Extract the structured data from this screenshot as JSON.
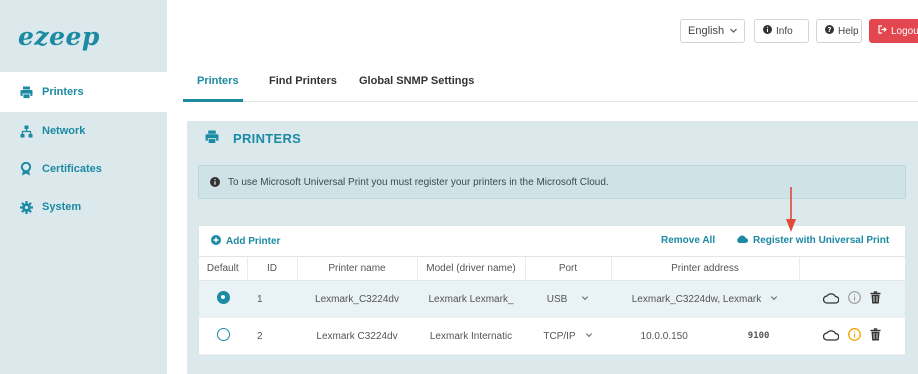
{
  "app": {
    "logo_text": "ezeep"
  },
  "sidebar": {
    "items": [
      {
        "label": "Printers",
        "icon": "printer-icon",
        "active": true
      },
      {
        "label": "Network",
        "icon": "network-icon",
        "active": false
      },
      {
        "label": "Certificates",
        "icon": "certificate-icon",
        "active": false
      },
      {
        "label": "System",
        "icon": "gear-icon",
        "active": false
      }
    ]
  },
  "header": {
    "language": "English",
    "info_label": "Info",
    "help_label": "Help",
    "logout_label": "Logout"
  },
  "tabs": [
    {
      "label": "Printers",
      "active": true
    },
    {
      "label": "Find Printers",
      "active": false
    },
    {
      "label": "Global SNMP Settings",
      "active": false
    }
  ],
  "panel": {
    "title": "PRINTERS",
    "alert": "To use Microsoft Universal Print you must register your printers in the Microsoft Cloud.",
    "add_printer": "Add Printer",
    "remove_all": "Remove All",
    "register": "Register with Universal Print"
  },
  "table": {
    "columns": [
      "Default",
      "ID",
      "Printer name",
      "Model (driver name)",
      "Port",
      "Printer address",
      ""
    ],
    "rows": [
      {
        "default": true,
        "id": "1",
        "name": "Lexmark_C3224dv",
        "model": "Lexmark Lexmark_",
        "port": "USB",
        "address": "Lexmark_C3224dw, Lexmark",
        "address_port": ""
      },
      {
        "default": false,
        "id": "2",
        "name": "Lexmark C3224dv",
        "model": "Lexmark Internatic",
        "port": "TCP/IP",
        "address": "10.0.0.150",
        "address_port": "9100"
      }
    ]
  },
  "colors": {
    "accent": "#1c8aa3",
    "logout": "#e2474f",
    "annotation_arrow": "#e04a3a",
    "info_highlight": "#f0a500"
  }
}
